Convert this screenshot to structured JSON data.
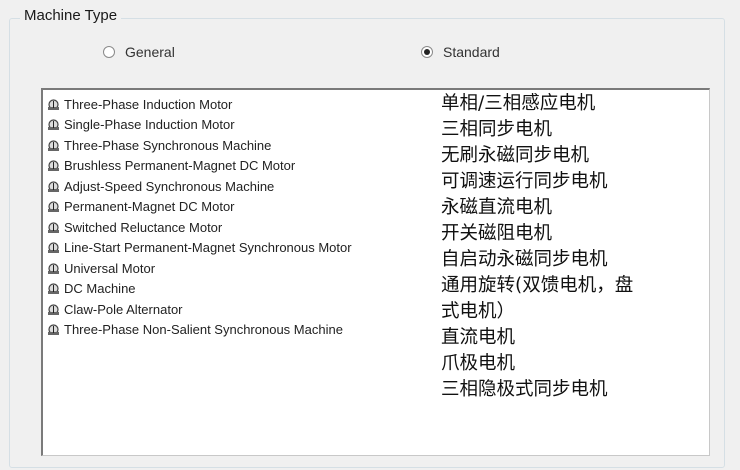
{
  "group": {
    "title": "Machine Type"
  },
  "options": {
    "general_label": "General",
    "standard_label": "Standard",
    "selected": "Standard"
  },
  "machines": [
    {
      "label": "Three-Phase Induction Motor",
      "icon": "induction-motor-icon"
    },
    {
      "label": "Single-Phase Induction Motor",
      "icon": "single-phase-motor-icon"
    },
    {
      "label": "Three-Phase Synchronous Machine",
      "icon": "synchronous-machine-icon"
    },
    {
      "label": "Brushless Permanent-Magnet DC Motor",
      "icon": "brushless-dc-motor-icon"
    },
    {
      "label": "Adjust-Speed  Synchronous Machine",
      "icon": "adjust-speed-machine-icon"
    },
    {
      "label": "Permanent-Magnet DC Motor",
      "icon": "pm-dc-motor-icon"
    },
    {
      "label": "Switched Reluctance Motor",
      "icon": "reluctance-motor-icon"
    },
    {
      "label": "Line-Start Permanent-Magnet Synchronous Motor",
      "icon": "line-start-motor-icon"
    },
    {
      "label": "Universal Motor",
      "icon": "universal-motor-icon"
    },
    {
      "label": "DC Machine",
      "icon": "dc-machine-icon"
    },
    {
      "label": "Claw-Pole Alternator",
      "icon": "claw-pole-alternator-icon"
    },
    {
      "label": "Three-Phase Non-Salient Synchronous Machine",
      "icon": "non-salient-machine-icon"
    }
  ],
  "translations": [
    "单相/三相感应电机",
    "三相同步电机",
    "无刷永磁同步电机",
    "可调速运行同步电机",
    "永磁直流电机",
    "开关磁阻电机",
    "自启动永磁同步电机",
    "通用旋转(双馈电机，盘",
    "式电机）",
    "直流电机",
    "爪极电机",
    "三相隐极式同步电机"
  ]
}
